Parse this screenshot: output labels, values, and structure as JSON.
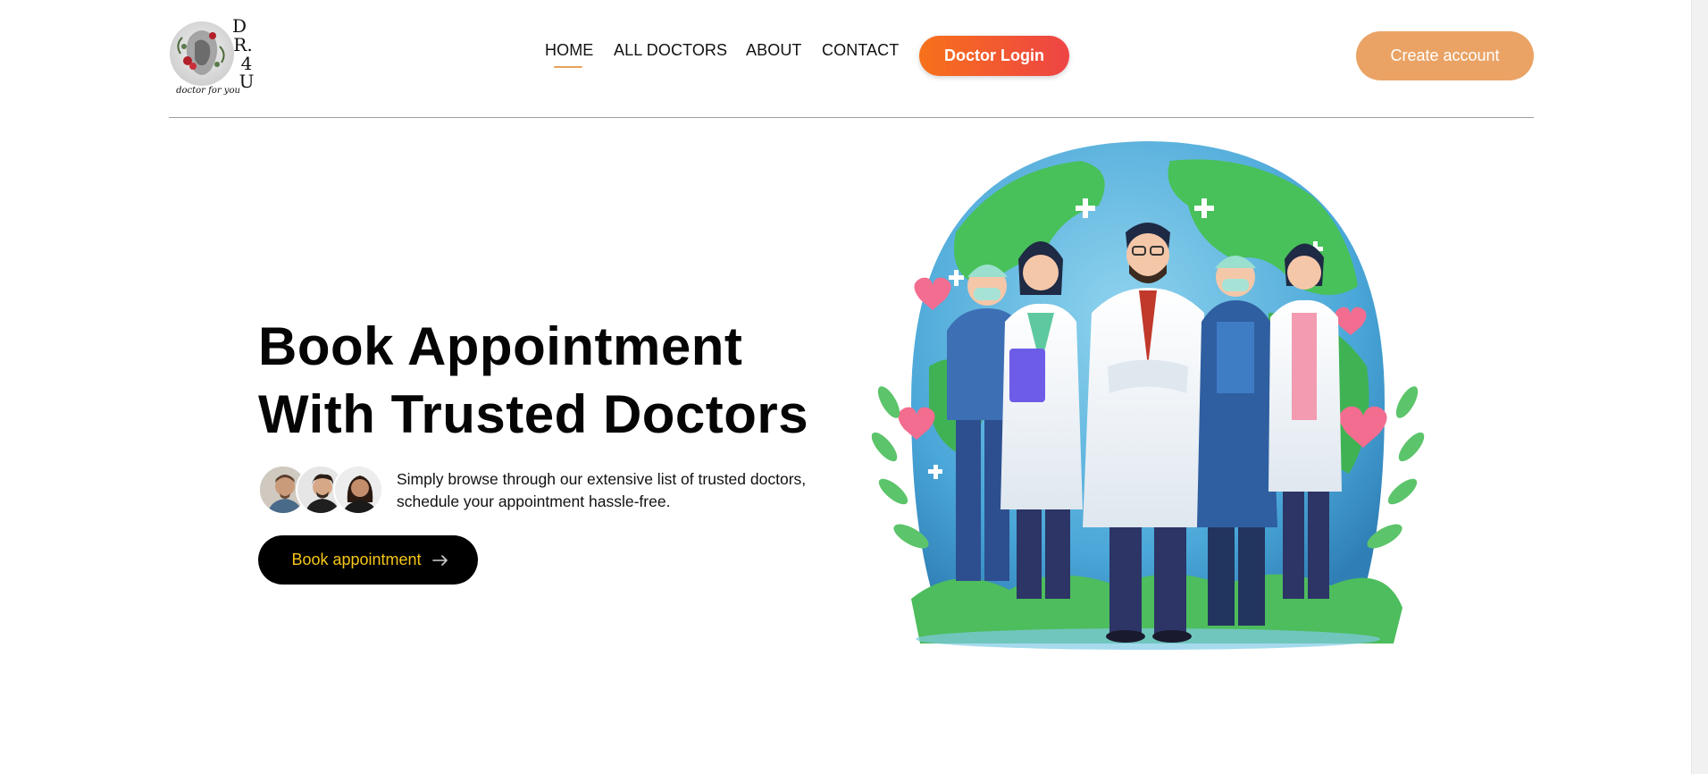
{
  "logo": {
    "brand_text": "DR.4U",
    "tagline": "doctor for you"
  },
  "nav": {
    "items": [
      {
        "label": "HOME",
        "active": true
      },
      {
        "label": "ALL DOCTORS",
        "active": false
      },
      {
        "label": "ABOUT",
        "active": false
      },
      {
        "label": "CONTACT",
        "active": false
      }
    ],
    "doctor_login_label": "Doctor Login",
    "create_account_label": "Create account"
  },
  "hero": {
    "title_line1": "Book Appointment",
    "title_line2": "With Trusted Doctors",
    "description": "Simply browse through our extensive list of trusted doctors, schedule your appointment hassle-free.",
    "book_button_label": "Book appointment",
    "book_button_icon": "arrow-right-icon"
  },
  "colors": {
    "accent_orange": "#eaa365",
    "doctor_login_gradient_start": "#f7711b",
    "doctor_login_gradient_end": "#ee4444",
    "book_button_bg": "#000000",
    "book_button_text": "#f5c518"
  }
}
